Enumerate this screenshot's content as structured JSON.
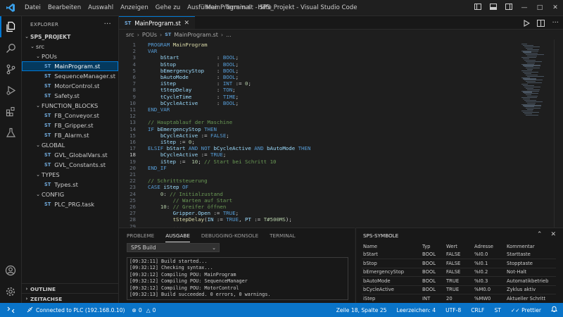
{
  "titlebar": {
    "menu": [
      "Datei",
      "Bearbeiten",
      "Auswahl",
      "Anzeigen",
      "Gehe zu",
      "Ausführen",
      "Terminal",
      "Hilfe"
    ],
    "window_title": "MainProgram.st - SPS_Projekt - Visual Studio Code"
  },
  "sidebar": {
    "header": "EXPLORER",
    "project": "SPS_PROJEKT",
    "items": [
      {
        "label": "src",
        "type": "folder",
        "depth": 1,
        "open": true
      },
      {
        "label": "POUs",
        "type": "folder",
        "depth": 2,
        "open": true
      },
      {
        "label": "MainProgram.st",
        "type": "file",
        "depth": 3,
        "selected": true
      },
      {
        "label": "SequenceManager.st",
        "type": "file",
        "depth": 3
      },
      {
        "label": "MotorControl.st",
        "type": "file",
        "depth": 3
      },
      {
        "label": "Safety.st",
        "type": "file",
        "depth": 3
      },
      {
        "label": "FUNCTION_BLOCKS",
        "type": "folder",
        "depth": 2,
        "open": true
      },
      {
        "label": "FB_Conveyor.st",
        "type": "file",
        "depth": 3
      },
      {
        "label": "FB_Gripper.st",
        "type": "file",
        "depth": 3
      },
      {
        "label": "FB_Alarm.st",
        "type": "file",
        "depth": 3
      },
      {
        "label": "GLOBAL",
        "type": "folder",
        "depth": 2,
        "open": true
      },
      {
        "label": "GVL_GlobalVars.st",
        "type": "file",
        "depth": 3
      },
      {
        "label": "GVL_Constants.st",
        "type": "file",
        "depth": 3
      },
      {
        "label": "TYPES",
        "type": "folder",
        "depth": 2,
        "open": true
      },
      {
        "label": "Types.st",
        "type": "file",
        "depth": 3
      },
      {
        "label": "CONFIG",
        "type": "folder",
        "depth": 2,
        "open": true
      },
      {
        "label": "PLC_PRG.task",
        "type": "file",
        "depth": 3
      }
    ],
    "outline": "OUTLINE",
    "timeline": "ZEITACHSE",
    "file_badge": "ST"
  },
  "editor": {
    "tab_label": "MainProgram.st",
    "breadcrumb": [
      "src",
      "POUs",
      "MainProgram.st",
      "..."
    ],
    "current_line": 18,
    "lines": [
      [
        [
          "kw",
          "PROGRAM "
        ],
        [
          "fn",
          "MainProgram"
        ]
      ],
      [
        [
          "kw",
          "VAR"
        ]
      ],
      [
        [
          "pl",
          "    "
        ],
        [
          "id",
          "bStart"
        ],
        [
          "pl",
          "            : "
        ],
        [
          "ty",
          "BOOL"
        ],
        [
          "pl",
          ";"
        ]
      ],
      [
        [
          "pl",
          "    "
        ],
        [
          "id",
          "bStop"
        ],
        [
          "pl",
          "             : "
        ],
        [
          "ty",
          "BOOL"
        ],
        [
          "pl",
          ";"
        ]
      ],
      [
        [
          "pl",
          "    "
        ],
        [
          "id",
          "bEmergencyStop"
        ],
        [
          "pl",
          "    : "
        ],
        [
          "ty",
          "BOOL"
        ],
        [
          "pl",
          ";"
        ]
      ],
      [
        [
          "pl",
          "    "
        ],
        [
          "id",
          "bAutoMode"
        ],
        [
          "pl",
          "         : "
        ],
        [
          "ty",
          "BOOL"
        ],
        [
          "pl",
          ";"
        ]
      ],
      [
        [
          "pl",
          "    "
        ],
        [
          "id",
          "iStep"
        ],
        [
          "pl",
          "             : "
        ],
        [
          "ty",
          "INT"
        ],
        [
          "pl",
          " := "
        ],
        [
          "nu",
          "0"
        ],
        [
          "pl",
          ";"
        ]
      ],
      [
        [
          "pl",
          "    "
        ],
        [
          "id",
          "tStepDelay"
        ],
        [
          "pl",
          "        : "
        ],
        [
          "ty",
          "TON"
        ],
        [
          "pl",
          ";"
        ]
      ],
      [
        [
          "pl",
          "    "
        ],
        [
          "id",
          "tCycleTime"
        ],
        [
          "pl",
          "        : "
        ],
        [
          "ty",
          "TIME"
        ],
        [
          "pl",
          ";"
        ]
      ],
      [
        [
          "pl",
          "    "
        ],
        [
          "id",
          "bCycleActive"
        ],
        [
          "pl",
          "      : "
        ],
        [
          "ty",
          "BOOL"
        ],
        [
          "pl",
          ";"
        ]
      ],
      [
        [
          "kw",
          "END_VAR"
        ]
      ],
      [
        [
          "pl",
          ""
        ]
      ],
      [
        [
          "cm",
          "// Hauptablauf der Maschine"
        ]
      ],
      [
        [
          "kw",
          "IF "
        ],
        [
          "id",
          "bEmergencyStop"
        ],
        [
          "kw",
          " THEN"
        ]
      ],
      [
        [
          "pl",
          "    "
        ],
        [
          "id",
          "bCycleActive"
        ],
        [
          "pl",
          " := "
        ],
        [
          "kw",
          "FALSE"
        ],
        [
          "pl",
          ";"
        ]
      ],
      [
        [
          "pl",
          "    "
        ],
        [
          "id",
          "iStep"
        ],
        [
          "pl",
          " := "
        ],
        [
          "nu",
          "0"
        ],
        [
          "pl",
          ";"
        ]
      ],
      [
        [
          "kw",
          "ELSIF "
        ],
        [
          "id",
          "bStart"
        ],
        [
          "kw",
          " AND NOT "
        ],
        [
          "id",
          "bCycleActive"
        ],
        [
          "kw",
          " AND "
        ],
        [
          "id",
          "bAutoMode"
        ],
        [
          "kw",
          " THEN"
        ]
      ],
      [
        [
          "pl",
          "    "
        ],
        [
          "id",
          "bCycleActive"
        ],
        [
          "pl",
          " := "
        ],
        [
          "kw",
          "TRUE"
        ],
        [
          "pl",
          ";"
        ]
      ],
      [
        [
          "pl",
          "    "
        ],
        [
          "id",
          "iStep"
        ],
        [
          "pl",
          " :=  "
        ],
        [
          "nu",
          "10"
        ],
        [
          "pl",
          "; "
        ],
        [
          "cm",
          "// Start bei Schritt 10"
        ]
      ],
      [
        [
          "kw",
          "END_IF"
        ]
      ],
      [
        [
          "pl",
          ""
        ]
      ],
      [
        [
          "cm",
          "// Schrittsteuerung"
        ]
      ],
      [
        [
          "kw",
          "CASE "
        ],
        [
          "id",
          "iStep"
        ],
        [
          "kw",
          " OF"
        ]
      ],
      [
        [
          "pl",
          "    "
        ],
        [
          "nu",
          "0"
        ],
        [
          "pl",
          ": "
        ],
        [
          "cm",
          "// Initialzustand"
        ]
      ],
      [
        [
          "pl",
          "        "
        ],
        [
          "cm",
          "// Warten auf Start"
        ]
      ],
      [
        [
          "pl",
          "    "
        ],
        [
          "nu",
          "10"
        ],
        [
          "pl",
          ": "
        ],
        [
          "cm",
          "// Greifer öffnen"
        ]
      ],
      [
        [
          "pl",
          "        "
        ],
        [
          "id",
          "Gripper"
        ],
        [
          "pl",
          "."
        ],
        [
          "id",
          "Open"
        ],
        [
          "pl",
          " := "
        ],
        [
          "kw",
          "TRUE"
        ],
        [
          "pl",
          ";"
        ]
      ],
      [
        [
          "pl",
          "        "
        ],
        [
          "fn",
          "tStepDelay"
        ],
        [
          "pl",
          "("
        ],
        [
          "id",
          "IN"
        ],
        [
          "pl",
          " := "
        ],
        [
          "kw",
          "TRUE"
        ],
        [
          "pl",
          ", "
        ],
        [
          "id",
          "PT"
        ],
        [
          "pl",
          " := "
        ],
        [
          "nu",
          "T#500MS"
        ],
        [
          "pl",
          ");"
        ]
      ],
      [
        [
          "pl",
          "        "
        ],
        [
          "pl",
          "..."
        ]
      ]
    ]
  },
  "panel": {
    "tabs": [
      "PROBLEME",
      "AUSGABE",
      "DEBUGGING-KONSOLE",
      "TERMINAL"
    ],
    "active_tab": "AUSGABE",
    "channel": "SPS Build",
    "output": [
      "[09:32:11] Build started...",
      "[09:32:12] Checking syntax...",
      "[09:32:12] Compiling POU: MainProgram",
      "[09:32:12] Compiling POU: SequenceManager",
      "[09:32:12] Compiling POU: MotorControl",
      "[09:32:13] Build succeeded. 0 errors, 0 warnings."
    ]
  },
  "symbols": {
    "title": "SPS-SYMBOLE",
    "columns": [
      "Name",
      "Typ",
      "Wert",
      "Adresse",
      "Kommentar"
    ],
    "rows": [
      [
        "bStart",
        "BOOL",
        "FALSE",
        "%I0.0",
        "Starttaste"
      ],
      [
        "bStop",
        "BOOL",
        "FALSE",
        "%I0.1",
        "Stopptaste"
      ],
      [
        "bEmergencyStop",
        "BOOL",
        "FALSE",
        "%I0.2",
        "Not-Halt"
      ],
      [
        "bAutoMode",
        "BOOL",
        "TRUE",
        "%I0.3",
        "Automatikbetrieb"
      ],
      [
        "bCycleActive",
        "BOOL",
        "TRUE",
        "%M0.0",
        "Zyklus aktiv"
      ],
      [
        "iStep",
        "INT",
        "20",
        "%MW0",
        "Aktueller Schritt"
      ]
    ]
  },
  "status": {
    "connection": "Connected to PLC (192.168.0.10)",
    "errors": "0",
    "warnings": "0",
    "position": "Zeile 18, Spalte 25",
    "indent": "Leerzeichen: 4",
    "encoding": "UTF-8",
    "eol": "CRLF",
    "language": "ST",
    "formatter": "Prettier"
  },
  "colors": {
    "accent": "#0078d4",
    "statusbar": "#0a74c8",
    "editor_bg": "#1e1e1e",
    "sidebar_bg": "#181818"
  }
}
